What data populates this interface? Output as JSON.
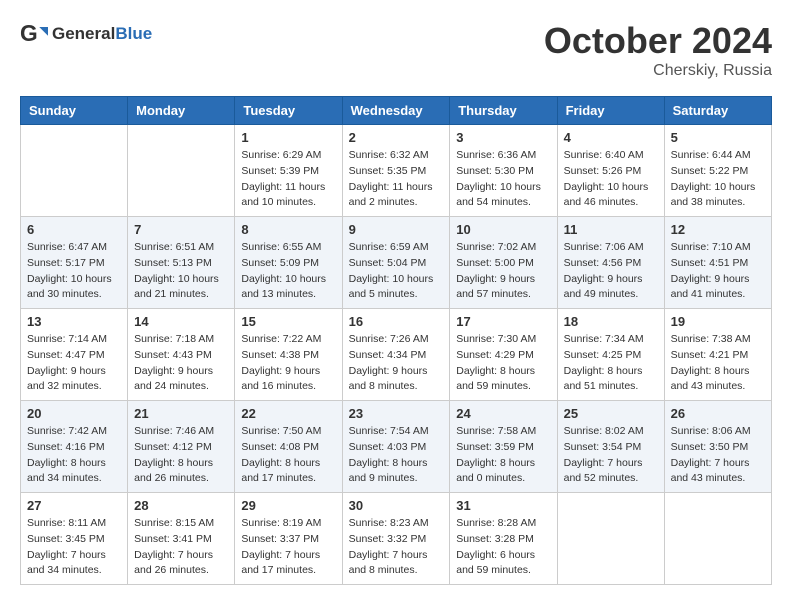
{
  "header": {
    "logo_general": "General",
    "logo_blue": "Blue",
    "title": "October 2024",
    "subtitle": "Cherskiy, Russia"
  },
  "weekdays": [
    "Sunday",
    "Monday",
    "Tuesday",
    "Wednesday",
    "Thursday",
    "Friday",
    "Saturday"
  ],
  "weeks": [
    [
      {
        "day": "",
        "info": ""
      },
      {
        "day": "",
        "info": ""
      },
      {
        "day": "1",
        "info": "Sunrise: 6:29 AM\nSunset: 5:39 PM\nDaylight: 11 hours\nand 10 minutes."
      },
      {
        "day": "2",
        "info": "Sunrise: 6:32 AM\nSunset: 5:35 PM\nDaylight: 11 hours\nand 2 minutes."
      },
      {
        "day": "3",
        "info": "Sunrise: 6:36 AM\nSunset: 5:30 PM\nDaylight: 10 hours\nand 54 minutes."
      },
      {
        "day": "4",
        "info": "Sunrise: 6:40 AM\nSunset: 5:26 PM\nDaylight: 10 hours\nand 46 minutes."
      },
      {
        "day": "5",
        "info": "Sunrise: 6:44 AM\nSunset: 5:22 PM\nDaylight: 10 hours\nand 38 minutes."
      }
    ],
    [
      {
        "day": "6",
        "info": "Sunrise: 6:47 AM\nSunset: 5:17 PM\nDaylight: 10 hours\nand 30 minutes."
      },
      {
        "day": "7",
        "info": "Sunrise: 6:51 AM\nSunset: 5:13 PM\nDaylight: 10 hours\nand 21 minutes."
      },
      {
        "day": "8",
        "info": "Sunrise: 6:55 AM\nSunset: 5:09 PM\nDaylight: 10 hours\nand 13 minutes."
      },
      {
        "day": "9",
        "info": "Sunrise: 6:59 AM\nSunset: 5:04 PM\nDaylight: 10 hours\nand 5 minutes."
      },
      {
        "day": "10",
        "info": "Sunrise: 7:02 AM\nSunset: 5:00 PM\nDaylight: 9 hours\nand 57 minutes."
      },
      {
        "day": "11",
        "info": "Sunrise: 7:06 AM\nSunset: 4:56 PM\nDaylight: 9 hours\nand 49 minutes."
      },
      {
        "day": "12",
        "info": "Sunrise: 7:10 AM\nSunset: 4:51 PM\nDaylight: 9 hours\nand 41 minutes."
      }
    ],
    [
      {
        "day": "13",
        "info": "Sunrise: 7:14 AM\nSunset: 4:47 PM\nDaylight: 9 hours\nand 32 minutes."
      },
      {
        "day": "14",
        "info": "Sunrise: 7:18 AM\nSunset: 4:43 PM\nDaylight: 9 hours\nand 24 minutes."
      },
      {
        "day": "15",
        "info": "Sunrise: 7:22 AM\nSunset: 4:38 PM\nDaylight: 9 hours\nand 16 minutes."
      },
      {
        "day": "16",
        "info": "Sunrise: 7:26 AM\nSunset: 4:34 PM\nDaylight: 9 hours\nand 8 minutes."
      },
      {
        "day": "17",
        "info": "Sunrise: 7:30 AM\nSunset: 4:29 PM\nDaylight: 8 hours\nand 59 minutes."
      },
      {
        "day": "18",
        "info": "Sunrise: 7:34 AM\nSunset: 4:25 PM\nDaylight: 8 hours\nand 51 minutes."
      },
      {
        "day": "19",
        "info": "Sunrise: 7:38 AM\nSunset: 4:21 PM\nDaylight: 8 hours\nand 43 minutes."
      }
    ],
    [
      {
        "day": "20",
        "info": "Sunrise: 7:42 AM\nSunset: 4:16 PM\nDaylight: 8 hours\nand 34 minutes."
      },
      {
        "day": "21",
        "info": "Sunrise: 7:46 AM\nSunset: 4:12 PM\nDaylight: 8 hours\nand 26 minutes."
      },
      {
        "day": "22",
        "info": "Sunrise: 7:50 AM\nSunset: 4:08 PM\nDaylight: 8 hours\nand 17 minutes."
      },
      {
        "day": "23",
        "info": "Sunrise: 7:54 AM\nSunset: 4:03 PM\nDaylight: 8 hours\nand 9 minutes."
      },
      {
        "day": "24",
        "info": "Sunrise: 7:58 AM\nSunset: 3:59 PM\nDaylight: 8 hours\nand 0 minutes."
      },
      {
        "day": "25",
        "info": "Sunrise: 8:02 AM\nSunset: 3:54 PM\nDaylight: 7 hours\nand 52 minutes."
      },
      {
        "day": "26",
        "info": "Sunrise: 8:06 AM\nSunset: 3:50 PM\nDaylight: 7 hours\nand 43 minutes."
      }
    ],
    [
      {
        "day": "27",
        "info": "Sunrise: 8:11 AM\nSunset: 3:45 PM\nDaylight: 7 hours\nand 34 minutes."
      },
      {
        "day": "28",
        "info": "Sunrise: 8:15 AM\nSunset: 3:41 PM\nDaylight: 7 hours\nand 26 minutes."
      },
      {
        "day": "29",
        "info": "Sunrise: 8:19 AM\nSunset: 3:37 PM\nDaylight: 7 hours\nand 17 minutes."
      },
      {
        "day": "30",
        "info": "Sunrise: 8:23 AM\nSunset: 3:32 PM\nDaylight: 7 hours\nand 8 minutes."
      },
      {
        "day": "31",
        "info": "Sunrise: 8:28 AM\nSunset: 3:28 PM\nDaylight: 6 hours\nand 59 minutes."
      },
      {
        "day": "",
        "info": ""
      },
      {
        "day": "",
        "info": ""
      }
    ]
  ]
}
